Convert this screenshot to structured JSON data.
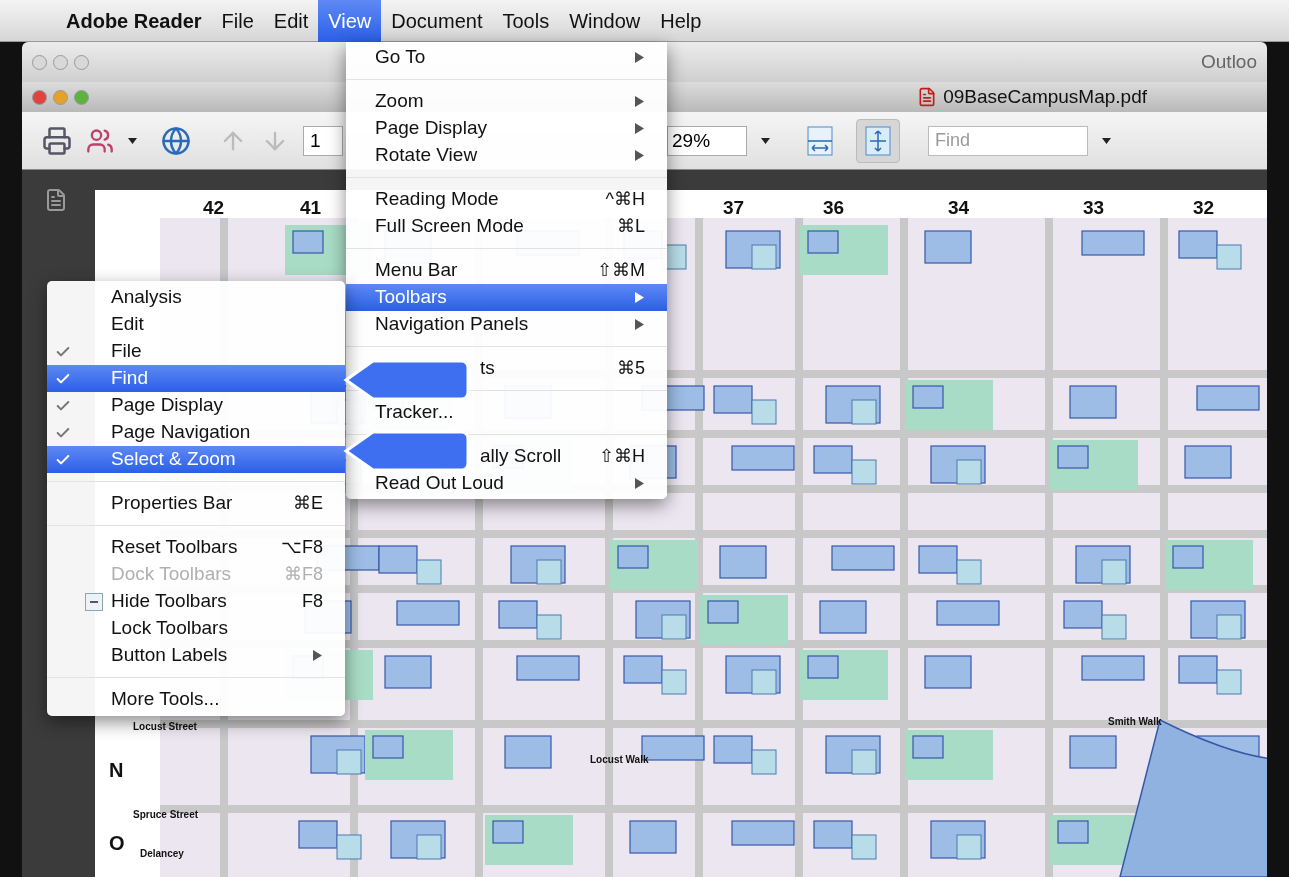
{
  "menu_bar": {
    "app": "Adobe Reader",
    "items": [
      {
        "label": "File",
        "selected": false
      },
      {
        "label": "Edit",
        "selected": false
      },
      {
        "label": "View",
        "selected": true
      },
      {
        "label": "Document",
        "selected": false
      },
      {
        "label": "Tools",
        "selected": false
      },
      {
        "label": "Window",
        "selected": false
      },
      {
        "label": "Help",
        "selected": false
      }
    ]
  },
  "background_window": {
    "title": "Outloo"
  },
  "window": {
    "title": "09BaseCampusMap.pdf"
  },
  "toolbar": {
    "page": "1",
    "zoom": "29%",
    "find_placeholder": "Find",
    "fit_width": {
      "selected": false
    },
    "fit_page": {
      "selected": true
    }
  },
  "view_menu": {
    "items": [
      {
        "kind": "item",
        "label": "Go To",
        "submenu": true,
        "selected": false
      },
      {
        "kind": "separator"
      },
      {
        "kind": "item",
        "label": "Zoom",
        "submenu": true,
        "selected": false
      },
      {
        "kind": "item",
        "label": "Page Display",
        "submenu": true,
        "selected": false
      },
      {
        "kind": "item",
        "label": "Rotate View",
        "submenu": true,
        "selected": false
      },
      {
        "kind": "separator"
      },
      {
        "kind": "item",
        "label": "Reading Mode",
        "shortcut": "^⌘H",
        "selected": false
      },
      {
        "kind": "item",
        "label": "Full Screen Mode",
        "shortcut": "⌘L",
        "selected": false
      },
      {
        "kind": "separator"
      },
      {
        "kind": "item",
        "label": "Menu Bar",
        "shortcut": "⇧⌘M",
        "selected": false
      },
      {
        "kind": "item",
        "label": "Toolbars",
        "submenu": true,
        "selected": true
      },
      {
        "kind": "item",
        "label": "Navigation Panels",
        "submenu": true,
        "selected": false
      },
      {
        "kind": "separator"
      },
      {
        "kind": "covered",
        "label": "ts",
        "shortcut": "⌘5",
        "selected": false
      },
      {
        "kind": "separator"
      },
      {
        "kind": "item",
        "label": "Tracker...",
        "selected": false
      },
      {
        "kind": "separator"
      },
      {
        "kind": "covered",
        "label": "ally Scroll",
        "shortcut": "⇧⌘H",
        "selected": false
      },
      {
        "kind": "item",
        "label": "Read Out Loud",
        "submenu": true,
        "selected": false
      }
    ]
  },
  "toolbars_submenu": {
    "items": [
      {
        "kind": "item",
        "label": "Analysis",
        "checked": false,
        "selected": false,
        "disabled": false
      },
      {
        "kind": "item",
        "label": "Edit",
        "checked": false,
        "selected": false,
        "disabled": false
      },
      {
        "kind": "item",
        "label": "File",
        "checked": true,
        "selected": false,
        "disabled": false
      },
      {
        "kind": "item",
        "label": "Find",
        "checked": true,
        "selected": true,
        "disabled": false
      },
      {
        "kind": "item",
        "label": "Page Display",
        "checked": true,
        "selected": false,
        "disabled": false
      },
      {
        "kind": "item",
        "label": "Page Navigation",
        "checked": true,
        "selected": false,
        "disabled": false
      },
      {
        "kind": "item",
        "label": "Select & Zoom",
        "checked": true,
        "selected": true,
        "disabled": false
      },
      {
        "kind": "separator"
      },
      {
        "kind": "item",
        "label": "Properties Bar",
        "shortcut": "⌘E",
        "checked": false,
        "selected": false,
        "disabled": false
      },
      {
        "kind": "separator"
      },
      {
        "kind": "item",
        "label": "Reset Toolbars",
        "shortcut": "⌥F8",
        "checked": false,
        "selected": false,
        "disabled": false
      },
      {
        "kind": "item",
        "label": "Dock Toolbars",
        "shortcut": "⌘F8",
        "checked": false,
        "selected": false,
        "disabled": true
      },
      {
        "kind": "boxed",
        "label": "Hide Toolbars",
        "shortcut": "F8",
        "checked": false,
        "selected": false,
        "disabled": false
      },
      {
        "kind": "item",
        "label": "Lock Toolbars",
        "checked": false,
        "selected": false,
        "disabled": false
      },
      {
        "kind": "item",
        "label": "Button Labels",
        "submenu": true,
        "checked": false,
        "selected": false,
        "disabled": false
      },
      {
        "kind": "separator"
      },
      {
        "kind": "item",
        "label": "More Tools...",
        "checked": false,
        "selected": false,
        "disabled": false
      }
    ]
  },
  "map": {
    "columns": [
      "42",
      "41",
      "37",
      "36",
      "34",
      "33",
      "32"
    ],
    "rows": [
      "N",
      "O"
    ],
    "streets": [
      "Locust Street",
      "Spruce Street",
      "Delancey",
      "Locust Walk",
      "Smith Walk"
    ]
  }
}
